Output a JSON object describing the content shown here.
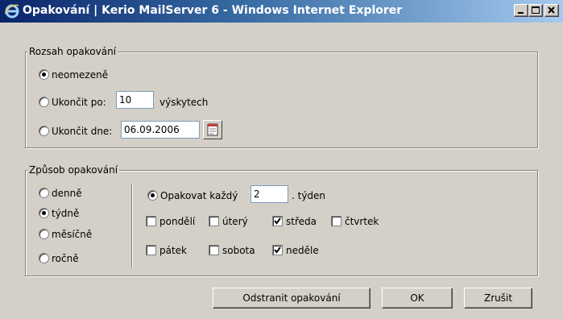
{
  "window": {
    "title": "Opakování | Kerio MailServer 6 - Windows Internet Explorer",
    "app_icon": "internet-explorer-icon",
    "controls": [
      "minimize-icon",
      "maximize-icon",
      "close-icon"
    ]
  },
  "range": {
    "legend": "Rozsah opakování",
    "options": [
      {
        "label": "neomezeně",
        "selected": true
      },
      {
        "label": "Ukončit po:",
        "value": "10",
        "suffix": "výskytech",
        "selected": false
      },
      {
        "label": "Ukončit dne:",
        "value": "06.09.2006",
        "selected": false,
        "icon": "calendar-icon"
      }
    ]
  },
  "mode": {
    "legend": "Způsob opakování",
    "frequencies": [
      {
        "label": "denně",
        "selected": false
      },
      {
        "label": "týdně",
        "selected": true
      },
      {
        "label": "měsíčně",
        "selected": false
      },
      {
        "label": "ročně",
        "selected": false
      }
    ],
    "repeat_label": "Opakovat každý",
    "repeat_value": "2",
    "repeat_unit": ". týden",
    "days": [
      {
        "label": "pondělí",
        "checked": false
      },
      {
        "label": "úterý",
        "checked": false
      },
      {
        "label": "středa",
        "checked": true
      },
      {
        "label": "čtvrtek",
        "checked": false
      },
      {
        "label": "pátek",
        "checked": false
      },
      {
        "label": "sobota",
        "checked": false
      },
      {
        "label": "neděle",
        "checked": true
      }
    ]
  },
  "buttons": {
    "remove": "Odstranit opakování",
    "ok": "OK",
    "cancel": "Zrušit"
  }
}
